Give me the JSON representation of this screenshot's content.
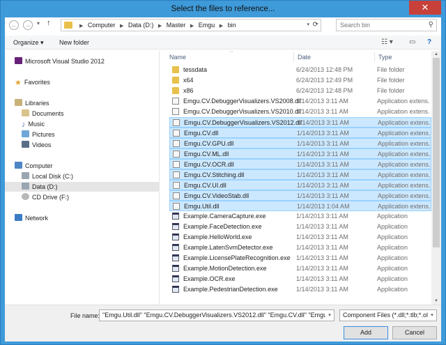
{
  "window": {
    "title": "Select the files to reference...",
    "close_glyph": "✕"
  },
  "address": {
    "crumbs": [
      "Computer",
      "Data (D:)",
      "Master",
      "Emgu",
      "bin"
    ]
  },
  "search": {
    "placeholder": "Search bin"
  },
  "toolbar": {
    "organize_label": "Organize ▾",
    "new_folder_label": "New folder"
  },
  "nav": {
    "vs": "Microsoft Visual Studio 2012",
    "favorites": "Favorites",
    "libraries": "Libraries",
    "documents": "Documents",
    "music": "Music",
    "pictures": "Pictures",
    "videos": "Videos",
    "computer": "Computer",
    "local_disk": "Local Disk (C:)",
    "data": "Data (D:)",
    "cd": "CD Drive (F:)",
    "network": "Network"
  },
  "columns": {
    "name": "Name",
    "date": "Date",
    "type": "Type"
  },
  "files": [
    {
      "name": "tessdata",
      "date": "6/24/2013 12:48 PM",
      "type": "File folder",
      "kind": "folder",
      "selected": false
    },
    {
      "name": "x64",
      "date": "6/24/2013 12:49 PM",
      "type": "File folder",
      "kind": "folder",
      "selected": false
    },
    {
      "name": "x86",
      "date": "6/24/2013 12:48 PM",
      "type": "File folder",
      "kind": "folder",
      "selected": false
    },
    {
      "name": "Emgu.CV.DebuggerVisualizers.VS2008.dll",
      "date": "1/14/2013 3:11 AM",
      "type": "Application extens...",
      "kind": "dll",
      "selected": false
    },
    {
      "name": "Emgu.CV.DebuggerVisualizers.VS2010.dll",
      "date": "1/14/2013 3:11 AM",
      "type": "Application extens...",
      "kind": "dll",
      "selected": false
    },
    {
      "name": "Emgu.CV.DebuggerVisualizers.VS2012.dll",
      "date": "1/14/2013 3:11 AM",
      "type": "Application extens...",
      "kind": "dll",
      "selected": true
    },
    {
      "name": "Emgu.CV.dll",
      "date": "1/14/2013 3:11 AM",
      "type": "Application extens...",
      "kind": "dll",
      "selected": true
    },
    {
      "name": "Emgu.CV.GPU.dll",
      "date": "1/14/2013 3:11 AM",
      "type": "Application extens...",
      "kind": "dll",
      "selected": true
    },
    {
      "name": "Emgu.CV.ML.dll",
      "date": "1/14/2013 3:11 AM",
      "type": "Application extens...",
      "kind": "dll",
      "selected": true
    },
    {
      "name": "Emgu.CV.OCR.dll",
      "date": "1/14/2013 3:11 AM",
      "type": "Application extens...",
      "kind": "dll",
      "selected": true
    },
    {
      "name": "Emgu.CV.Stitching.dll",
      "date": "1/14/2013 3:11 AM",
      "type": "Application extens...",
      "kind": "dll",
      "selected": true
    },
    {
      "name": "Emgu.CV.UI.dll",
      "date": "1/14/2013 3:11 AM",
      "type": "Application extens...",
      "kind": "dll",
      "selected": true
    },
    {
      "name": "Emgu.CV.VideoStab.dll",
      "date": "1/14/2013 3:11 AM",
      "type": "Application extens...",
      "kind": "dll",
      "selected": true
    },
    {
      "name": "Emgu.Util.dll",
      "date": "1/14/2013 1:04 AM",
      "type": "Application extens...",
      "kind": "dll",
      "selected": true
    },
    {
      "name": "Example.CameraCapture.exe",
      "date": "1/14/2013 3:11 AM",
      "type": "Application",
      "kind": "exe",
      "selected": false
    },
    {
      "name": "Example.FaceDetection.exe",
      "date": "1/14/2013 3:11 AM",
      "type": "Application",
      "kind": "exe",
      "selected": false
    },
    {
      "name": "Example.HelloWorld.exe",
      "date": "1/14/2013 3:11 AM",
      "type": "Application",
      "kind": "exe",
      "selected": false
    },
    {
      "name": "Example.LatenSvmDetector.exe",
      "date": "1/14/2013 3:11 AM",
      "type": "Application",
      "kind": "exe",
      "selected": false
    },
    {
      "name": "Example.LicensePlateRecognition.exe",
      "date": "1/14/2013 3:11 AM",
      "type": "Application",
      "kind": "exe",
      "selected": false
    },
    {
      "name": "Example.MotionDetection.exe",
      "date": "1/14/2013 3:11 AM",
      "type": "Application",
      "kind": "exe",
      "selected": false
    },
    {
      "name": "Example.OCR.exe",
      "date": "1/14/2013 3:11 AM",
      "type": "Application",
      "kind": "exe",
      "selected": false
    },
    {
      "name": "Example.PedestrianDetection.exe",
      "date": "1/14/2013 3:11 AM",
      "type": "Application",
      "kind": "exe",
      "selected": false
    }
  ],
  "bottom": {
    "filename_label": "File name:",
    "filename_value": "\"Emgu.Util.dll\" \"Emgu.CV.DebuggerVisualizers.VS2012.dll\" \"Emgu.CV.dll\" \"Emgu.CV.G",
    "filter_value": "Component Files (*.dll;*.tlb;*.ol",
    "add_label": "Add",
    "cancel_label": "Cancel"
  }
}
